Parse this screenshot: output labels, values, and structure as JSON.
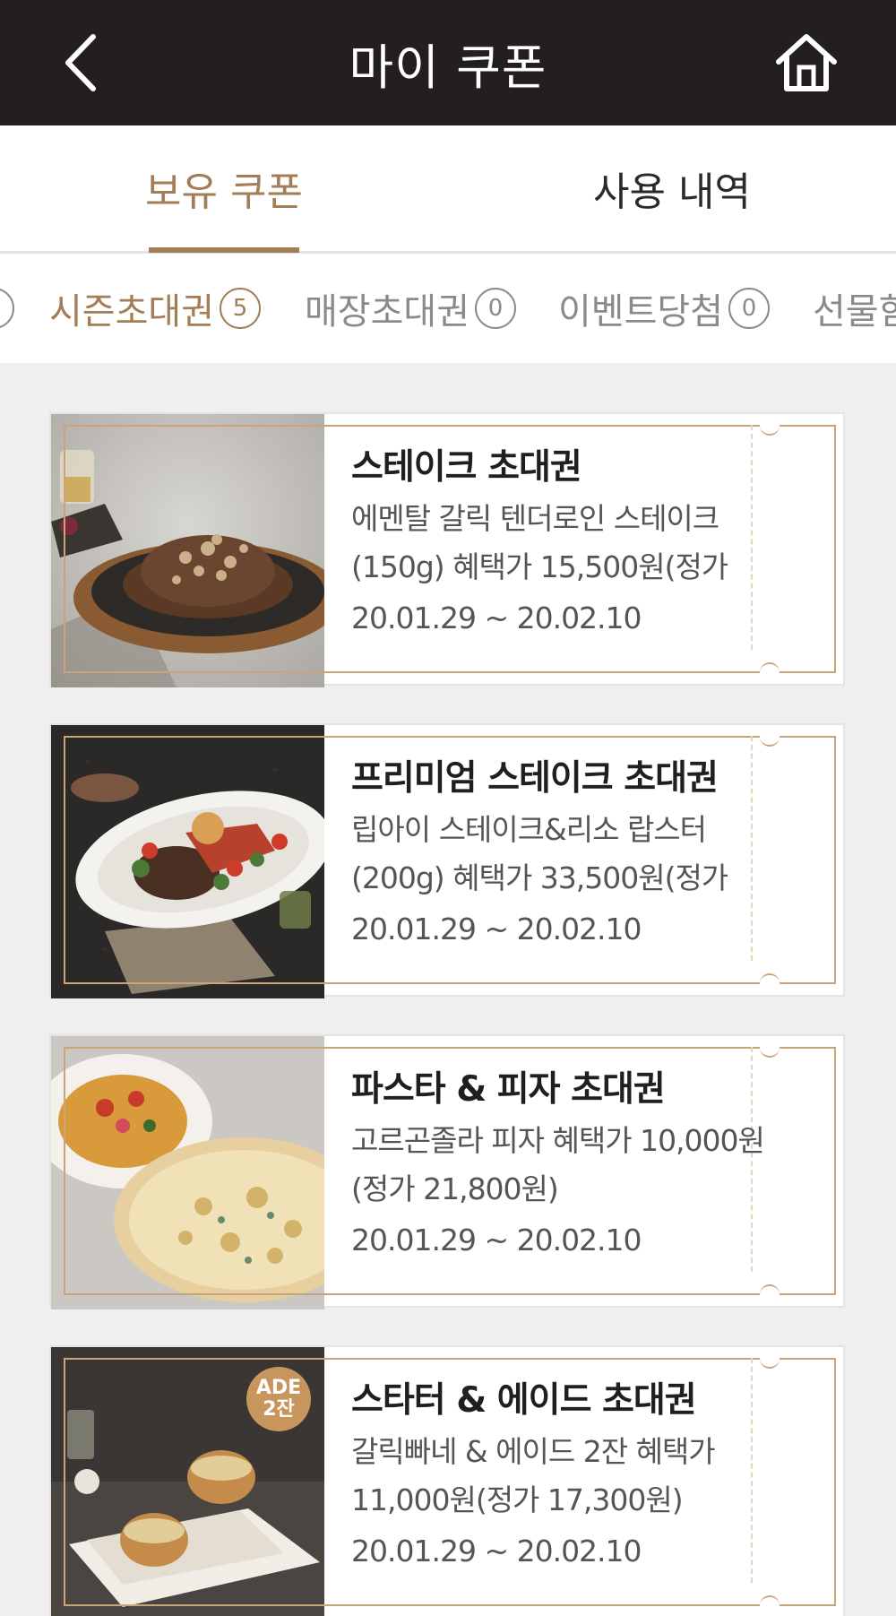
{
  "header": {
    "title": "마이 쿠폰",
    "back_icon": "chevron-left-icon",
    "home_icon": "home-icon"
  },
  "main_tabs": [
    {
      "label": "보유 쿠폰",
      "active": true
    },
    {
      "label": "사용 내역",
      "active": false
    }
  ],
  "sub_tabs": [
    {
      "label": "",
      "count": "",
      "active": false
    },
    {
      "label": "시즌초대권",
      "count": "5",
      "active": true
    },
    {
      "label": "매장초대권",
      "count": "0",
      "active": false
    },
    {
      "label": "이벤트당첨",
      "count": "0",
      "active": false
    },
    {
      "label": "선물함",
      "count": "",
      "active": false
    }
  ],
  "coupons": [
    {
      "title": "스테이크 초대권",
      "desc": "에멘탈 갈릭 텐더로인 스테이크 (150g) 혜택가 15,500원(정가",
      "date": "20.01.29 ~ 20.02.10",
      "image": "steak-platter-image"
    },
    {
      "title": "프리미엄 스테이크 초대권",
      "desc": "립아이 스테이크&리소 랍스터 (200g) 혜택가 33,500원(정가",
      "date": "20.01.29 ~ 20.02.10",
      "image": "steak-lobster-image"
    },
    {
      "title": "파스타 & 피자 초대권",
      "desc": "고르곤졸라 피자 혜택가 10,000원(정가 21,800원)",
      "date": "20.01.29 ~ 20.02.10",
      "image": "pasta-pizza-image"
    },
    {
      "title": "스타터 & 에이드 초대권",
      "desc": "갈릭빠네 & 에이드 2잔 혜택가 11,000원(정가 17,300원)",
      "date": "20.01.29 ~ 20.02.10",
      "image": "garlic-bread-image",
      "badge_line1": "ADE",
      "badge_line2": "2잔"
    }
  ],
  "colors": {
    "header_bg": "#231f20",
    "accent": "#a27d55",
    "frame": "#c9a47a"
  }
}
